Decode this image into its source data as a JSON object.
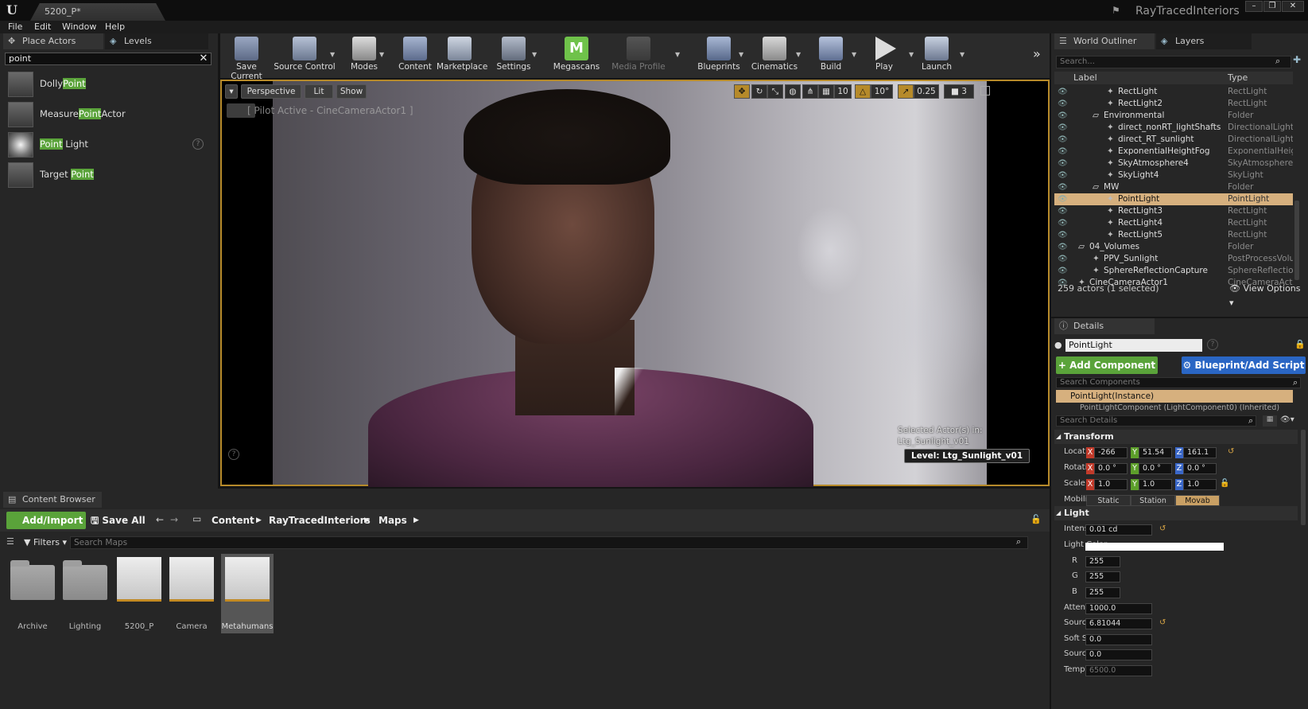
{
  "titlebar": {
    "tab": "5200_P*",
    "project": "RayTracedInteriors"
  },
  "menu": [
    "File",
    "Edit",
    "Window",
    "Help"
  ],
  "place_actors": {
    "tabs": [
      "Place Actors",
      "Levels"
    ],
    "search_value": "point",
    "items": [
      {
        "pre": "Dolly",
        "hl": "Point",
        "post": ""
      },
      {
        "pre": "Measure",
        "hl": "Point",
        "post": "Actor"
      },
      {
        "pre": "",
        "hl": "Point",
        "post": " Light"
      },
      {
        "pre": "Target ",
        "hl": "Point",
        "post": ""
      }
    ]
  },
  "toolbar": {
    "buttons": [
      "Save Current",
      "Source Control",
      "Modes",
      "Content",
      "Marketplace",
      "Settings",
      "Megascans",
      "Media Profile",
      "Blueprints",
      "Cinematics",
      "Build",
      "Play",
      "Launch"
    ]
  },
  "viewport": {
    "perspective": "Perspective",
    "lit": "Lit",
    "show": "Show",
    "grid": "10",
    "angle": "10°",
    "scale": "0.25",
    "cams": "3",
    "pilot": "[ Pilot Active - CineCameraActor1 ]",
    "selected_line1": "Selected Actor(s) in:",
    "selected_line2": "Ltg_Sunlight_v01",
    "level": "Level:  Ltg_Sunlight_v01",
    "help": "?"
  },
  "content_browser": {
    "tab": "Content Browser",
    "add_import": "Add/Import",
    "save_all": "Save All",
    "crumbs": [
      "Content",
      "RayTracedInteriors",
      "Maps"
    ],
    "filters": "Filters",
    "search_placeholder": "Search Maps",
    "assets": [
      "Archive",
      "Lighting",
      "5200_P",
      "Camera",
      "Metahumans"
    ]
  },
  "outliner": {
    "tabs": [
      "World Outliner",
      "Layers"
    ],
    "search_placeholder": "Search...",
    "col_label": "Label",
    "col_type": "Type",
    "rows": [
      {
        "name": "RectLight",
        "type": "RectLight",
        "indent": 2
      },
      {
        "name": "RectLight2",
        "type": "RectLight",
        "indent": 2
      },
      {
        "name": "Environmental",
        "type": "Folder",
        "indent": 1
      },
      {
        "name": "direct_nonRT_lightShafts",
        "type": "DirectionalLight",
        "indent": 2
      },
      {
        "name": "direct_RT_sunlight",
        "type": "DirectionalLight",
        "indent": 2
      },
      {
        "name": "ExponentialHeightFog",
        "type": "ExponentialHeigh",
        "indent": 2
      },
      {
        "name": "SkyAtmosphere4",
        "type": "SkyAtmosphere",
        "indent": 2
      },
      {
        "name": "SkyLight4",
        "type": "SkyLight",
        "indent": 2
      },
      {
        "name": "MW",
        "type": "Folder",
        "indent": 1
      },
      {
        "name": "PointLight",
        "type": "PointLight",
        "indent": 2
      },
      {
        "name": "RectLight3",
        "type": "RectLight",
        "indent": 2
      },
      {
        "name": "RectLight4",
        "type": "RectLight",
        "indent": 2
      },
      {
        "name": "RectLight5",
        "type": "RectLight",
        "indent": 2
      },
      {
        "name": "04_Volumes",
        "type": "Folder",
        "indent": 0
      },
      {
        "name": "PPV_Sunlight",
        "type": "PostProcessVolur",
        "indent": 1
      },
      {
        "name": "SphereReflectionCapture",
        "type": "SphereReflectionC",
        "indent": 1
      },
      {
        "name": "CineCameraActor1",
        "type": "CineCameraActor",
        "indent": 0
      }
    ],
    "footer": "259 actors (1 selected)",
    "view_options": "View Options"
  },
  "details": {
    "tab": "Details",
    "actor_name": "PointLight",
    "add_component": "Add Component",
    "blueprint": "Blueprint/Add Script",
    "search_components": "Search Components",
    "instance": "PointLight(Instance)",
    "sub_component": "PointLightComponent (LightComponent0) (Inherited)",
    "search_details": "Search Details",
    "transform": "Transform",
    "location_label": "Location",
    "location": [
      "-266",
      "51.54",
      "161.1"
    ],
    "rotation_label": "Rotation",
    "rotation": [
      "0.0 °",
      "0.0 °",
      "0.0 °"
    ],
    "scale_label": "Scale",
    "scale": [
      "1.0",
      "1.0",
      "1.0"
    ],
    "mobility_label": "Mobility",
    "mobility": [
      "Static",
      "Station",
      "Movab"
    ],
    "light": "Light",
    "intensity_label": "Intensity",
    "intensity": "0.01 cd",
    "light_color_label": "Light Color",
    "r_label": "R",
    "r": "255",
    "g_label": "G",
    "g": "255",
    "b_label": "B",
    "b": "255",
    "atten_label": "Attenuation Radius",
    "atten": "1000.0",
    "source_radius_label": "Source Radius",
    "source_radius": "6.81044",
    "soft_radius_label": "Soft Source Radius",
    "soft_radius": "0.0",
    "source_length_label": "Source Length",
    "source_length": "0.0",
    "temperature_label": "Temperature",
    "temperature": "6500.0"
  }
}
